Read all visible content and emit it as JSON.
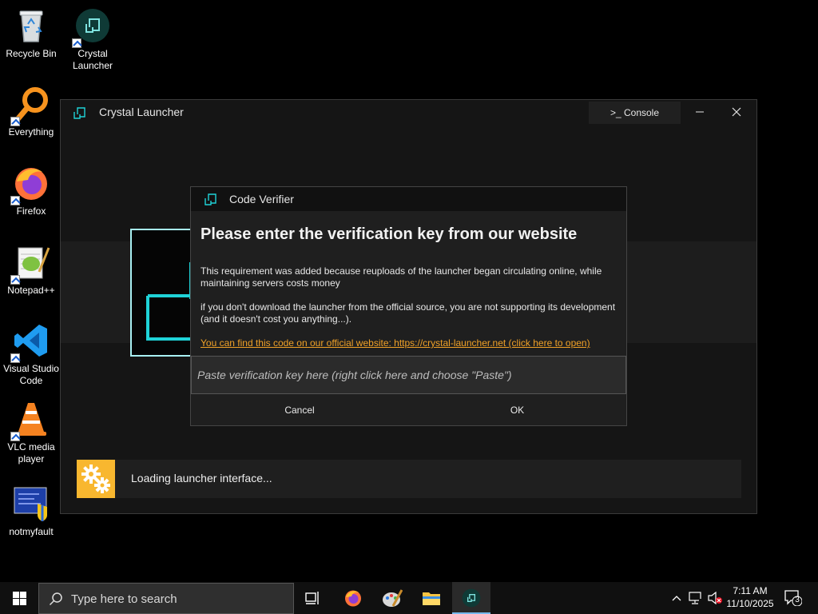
{
  "desktop": {
    "icons": [
      {
        "label": "Recycle Bin"
      },
      {
        "label": "Crystal Launcher"
      },
      {
        "label": "Everything"
      },
      {
        "label": "Firefox"
      },
      {
        "label": "Notepad++"
      },
      {
        "label": "Visual Studio Code"
      },
      {
        "label": "VLC media player"
      },
      {
        "label": "notmyfault"
      }
    ]
  },
  "launcher": {
    "title": "Crystal Launcher",
    "console_label": ">_ Console",
    "status_text": "Loading launcher interface..."
  },
  "dialog": {
    "title": "Code Verifier",
    "heading": "Please enter the verification key from our website",
    "paragraph1": "This requirement was added because reuploads of the launcher began circulating online, while maintaining servers costs money",
    "paragraph2": "if you don't download the launcher from the official source, you are not supporting its development (and it doesn't cost you anything...).",
    "link_text": "You can find this code on our official website: https://crystal-launcher.net (click here to open)",
    "input_placeholder": "Paste verification key here (right click here and choose \"Paste\")",
    "input_value": "",
    "cancel_label": "Cancel",
    "ok_label": "OK"
  },
  "taskbar": {
    "search_placeholder": "Type here to search",
    "time": "7:11 AM",
    "date": "11/10/2025",
    "notification_count": "3"
  },
  "colors": {
    "accent_cyan": "#1fd3d8",
    "link_orange": "#f0a127",
    "gear_tile": "#f8b72f",
    "taskbar_active": "#76b9ed"
  }
}
